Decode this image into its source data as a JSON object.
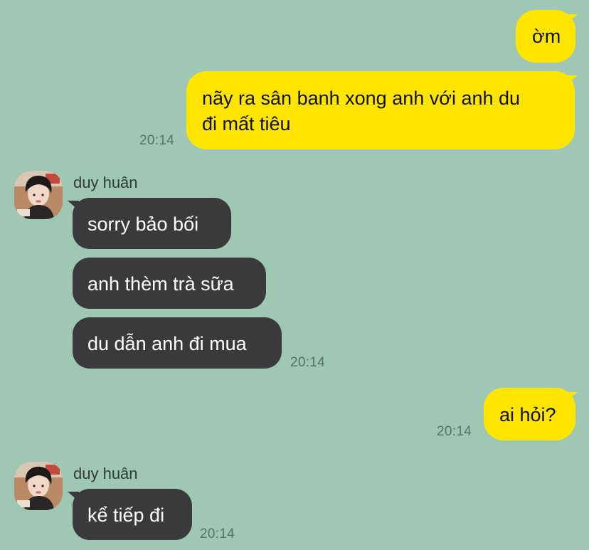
{
  "messages": {
    "m1": {
      "text": "ờm"
    },
    "m2": {
      "line1": "nãy ra sân banh xong anh với anh du",
      "line2": "đi mất tiêu",
      "time": "20:14"
    },
    "g1": {
      "sender": "duy huân",
      "b1": "sorry bảo bối",
      "b2": "anh thèm trà sữa",
      "b3": "du dẫn anh đi mua",
      "time": "20:14"
    },
    "m3": {
      "text": "ai hỏi?",
      "time": "20:14"
    },
    "g2": {
      "sender": "duy huân",
      "b1": "kể tiếp đi",
      "time": "20:14"
    }
  },
  "colors": {
    "background": "#9ec7b4",
    "outgoing_bubble": "#ffe500",
    "incoming_bubble": "#3a3a3d"
  },
  "icons": {
    "avatar": "profile-photo-avatar"
  }
}
